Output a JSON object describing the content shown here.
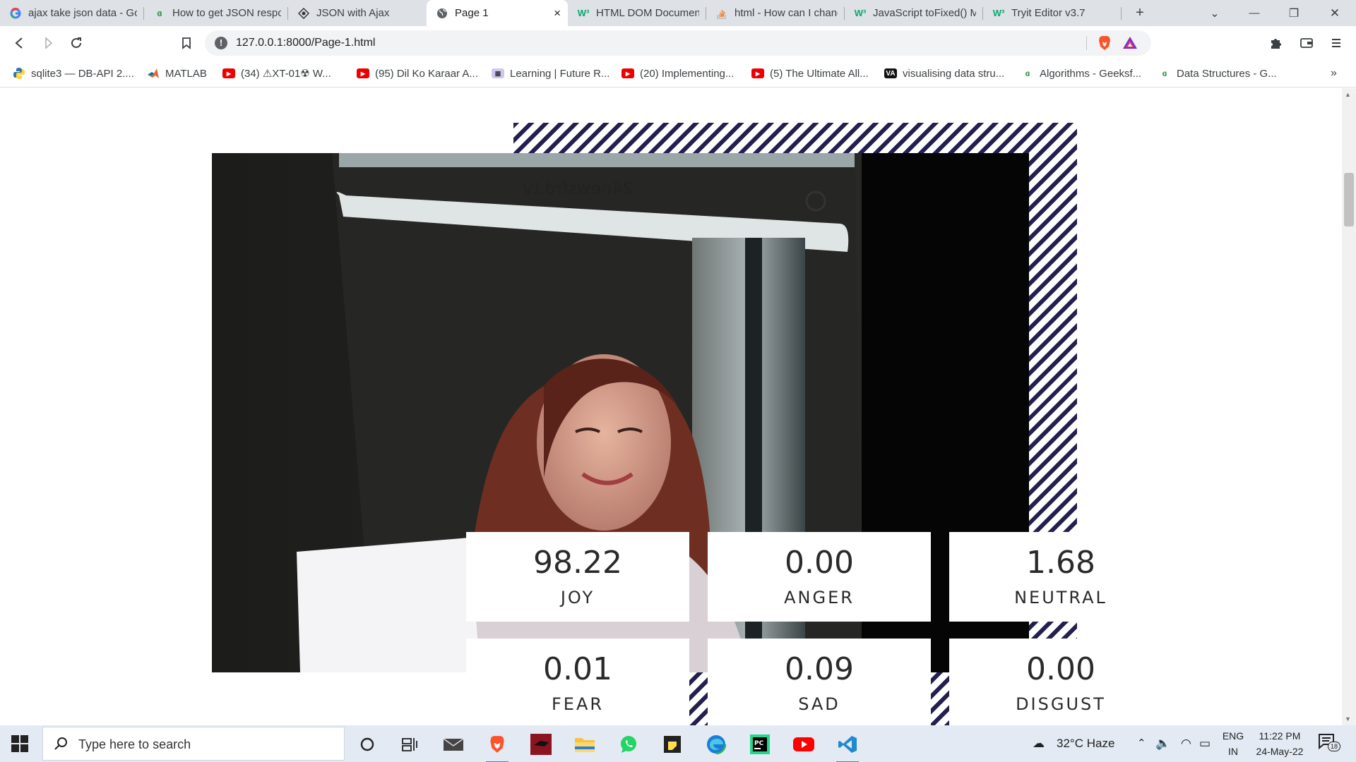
{
  "tabs": [
    {
      "title": "ajax take json data - Go",
      "icon": "google-icon"
    },
    {
      "title": "How to get JSON respo",
      "icon": "geeksforgeeks-icon"
    },
    {
      "title": "JSON with Ajax",
      "icon": "tutorialspoint-icon"
    },
    {
      "title": "Page 1",
      "icon": "globe-icon",
      "active": true,
      "close": "×"
    },
    {
      "title": "HTML DOM Document",
      "icon": "w3schools-icon"
    },
    {
      "title": "html - How can I chang",
      "icon": "stackoverflow-icon"
    },
    {
      "title": "JavaScript toFixed() Me",
      "icon": "w3schools-icon"
    },
    {
      "title": "Tryit Editor v3.7",
      "icon": "w3schools-icon"
    }
  ],
  "tab_controls": {
    "new_tab": "+",
    "tab_search": "⌄",
    "minimize": "—",
    "restore": "❐",
    "close": "✕"
  },
  "address_bar": {
    "url": "127.0.0.1:8000/Page-1.html"
  },
  "bookmarks": [
    {
      "label": "sqlite3 — DB-API 2....",
      "icon": "python-icon"
    },
    {
      "label": "MATLAB",
      "icon": "matlab-icon"
    },
    {
      "label": "(34) ⚠XT-01☢ W...",
      "icon": "youtube-icon"
    },
    {
      "label": "(95) Dil Ko Karaar A...",
      "icon": "youtube-icon"
    },
    {
      "label": "Learning | Future R...",
      "icon": "futurelearn-icon"
    },
    {
      "label": "(20) Implementing...",
      "icon": "youtube-icon"
    },
    {
      "label": "(5) The Ultimate All...",
      "icon": "youtube-icon"
    },
    {
      "label": "visualising data stru...",
      "icon": "visualgo-icon"
    },
    {
      "label": "Algorithms - Geeksf...",
      "icon": "geeksforgeeks-icon"
    },
    {
      "label": "Data Structures - G...",
      "icon": "geeksforgeeks-icon"
    }
  ],
  "bookmarks_more": "»",
  "photo": {
    "screen_text": "24newsfrd.tv"
  },
  "emotions": [
    {
      "value": "98.22",
      "label": "JOY"
    },
    {
      "value": "0.00",
      "label": "ANGER"
    },
    {
      "value": "1.68",
      "label": "NEUTRAL"
    },
    {
      "value": "0.01",
      "label": "FEAR"
    },
    {
      "value": "0.09",
      "label": "SAD"
    },
    {
      "value": "0.00",
      "label": "DISGUST"
    }
  ],
  "taskbar": {
    "search_placeholder": "Type here to search",
    "weather": "32°C  Haze",
    "lang_line1": "ENG",
    "lang_line2": "IN",
    "time": "11:22 PM",
    "date": "24-May-22",
    "notifications": "18"
  },
  "colors": {
    "stripe": "#23204f",
    "accent": "#3a84d6"
  }
}
